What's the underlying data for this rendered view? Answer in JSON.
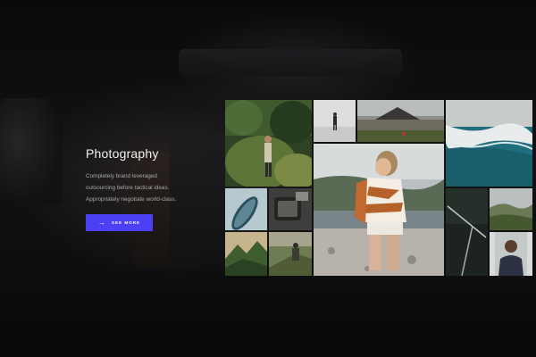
{
  "hero": {
    "title": "Photography",
    "description_lines": [
      "Completely brand leveraged",
      "outsourcing before tactical ideas.",
      "Appropriately negotiate world-class."
    ],
    "cta_label": "SEE MORE",
    "cta_icon": "arrow-right-icon",
    "accent_color": "#4d3ff3"
  },
  "gallery": {
    "photos": [
      {
        "subject": "hiker-in-forest"
      },
      {
        "subject": "person-on-snow-field"
      },
      {
        "subject": "mountain-crater-landscape"
      },
      {
        "subject": "ocean-waves-aerial"
      },
      {
        "subject": "surfboard"
      },
      {
        "subject": "camera-gear"
      },
      {
        "subject": "woman-striped-sweater-beach"
      },
      {
        "subject": "road-aerial"
      },
      {
        "subject": "green-hills"
      },
      {
        "subject": "mountain-valley"
      },
      {
        "subject": "hiker-sitting"
      },
      {
        "subject": "man-portrait"
      }
    ]
  }
}
